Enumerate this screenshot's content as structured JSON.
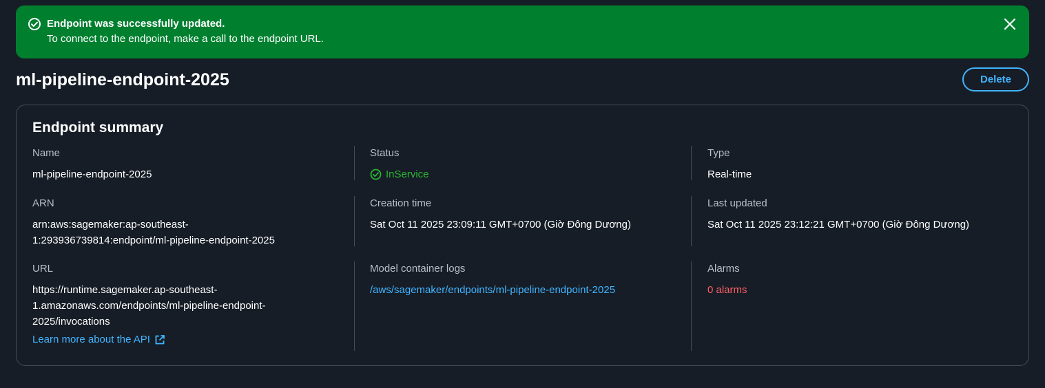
{
  "flash": {
    "title": "Endpoint was successfully updated.",
    "message": "To connect to the endpoint, make a call to the endpoint URL.",
    "icon": "success-check-icon",
    "close_icon": "close-icon",
    "background": "#00802f"
  },
  "page": {
    "title": "ml-pipeline-endpoint-2025",
    "delete_label": "Delete"
  },
  "summary": {
    "title": "Endpoint summary",
    "name": {
      "label": "Name",
      "value": "ml-pipeline-endpoint-2025"
    },
    "status": {
      "label": "Status",
      "value": "InService",
      "color": "#2bb534",
      "icon": "status-success-icon"
    },
    "type": {
      "label": "Type",
      "value": "Real-time"
    },
    "arn": {
      "label": "ARN",
      "line1": "arn:aws:sagemaker:ap-southeast-",
      "line2": "1:293936739814:endpoint/ml-pipeline-endpoint-2025"
    },
    "creation_time": {
      "label": "Creation time",
      "value": "Sat Oct 11 2025 23:09:11 GMT+0700 (Giờ Đông Dương)"
    },
    "last_updated": {
      "label": "Last updated",
      "value": "Sat Oct 11 2025 23:12:21 GMT+0700 (Giờ Đông Dương)"
    },
    "url": {
      "label": "URL",
      "line1": "https://runtime.sagemaker.ap-southeast-",
      "line2": "1.amazonaws.com/endpoints/ml-pipeline-endpoint-",
      "line3": "2025/invocations",
      "learn_more": "Learn more about the API",
      "learn_more_icon": "external-link-icon"
    },
    "logs": {
      "label": "Model container logs",
      "value": "/aws/sagemaker/endpoints/ml-pipeline-endpoint-2025"
    },
    "alarms": {
      "label": "Alarms",
      "value": "0 alarms",
      "color": "#ff5d64"
    }
  },
  "colors": {
    "page_background": "#161d26",
    "link": "#42b4ff",
    "border": "#414d5c"
  }
}
